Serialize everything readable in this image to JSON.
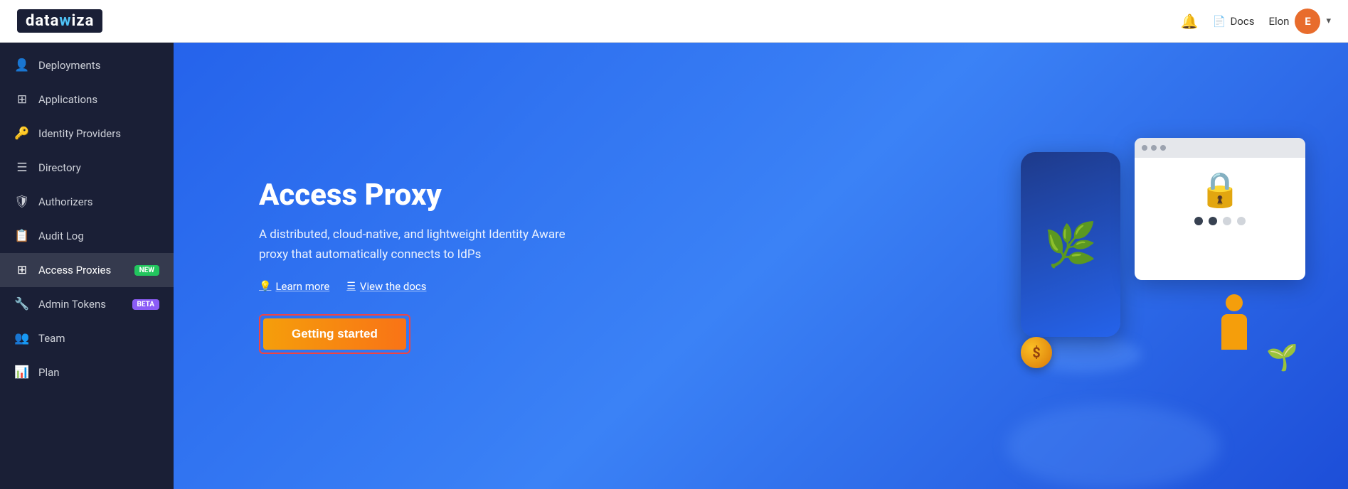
{
  "header": {
    "logo": "datawiza",
    "bell_label": "🔔",
    "docs_label": "Docs",
    "user_name": "Elon",
    "avatar_initials": "E",
    "chevron": "▾"
  },
  "sidebar": {
    "items": [
      {
        "id": "deployments",
        "label": "Deployments",
        "icon": "👤",
        "badge": null
      },
      {
        "id": "applications",
        "label": "Applications",
        "icon": "⊞",
        "badge": null
      },
      {
        "id": "identity-providers",
        "label": "Identity Providers",
        "icon": "🔑",
        "badge": null
      },
      {
        "id": "directory",
        "label": "Directory",
        "icon": "☰",
        "badge": null
      },
      {
        "id": "authorizers",
        "label": "Authorizers",
        "icon": "🛡",
        "badge": null
      },
      {
        "id": "audit-log",
        "label": "Audit Log",
        "icon": "📋",
        "badge": null
      },
      {
        "id": "access-proxies",
        "label": "Access Proxies",
        "icon": "⊞",
        "badge": "New",
        "badge_type": "new",
        "active": true
      },
      {
        "id": "admin-tokens",
        "label": "Admin Tokens",
        "icon": "🔧",
        "badge": "Beta",
        "badge_type": "beta"
      },
      {
        "id": "team",
        "label": "Team",
        "icon": "👥",
        "badge": null
      },
      {
        "id": "plan",
        "label": "Plan",
        "icon": "📊",
        "badge": null
      }
    ]
  },
  "main": {
    "title": "Access Proxy",
    "description": "A distributed, cloud-native, and lightweight Identity Aware proxy that automatically connects to IdPs",
    "learn_more_label": "Learn more",
    "view_docs_label": "View the docs",
    "getting_started_label": "Getting started"
  }
}
